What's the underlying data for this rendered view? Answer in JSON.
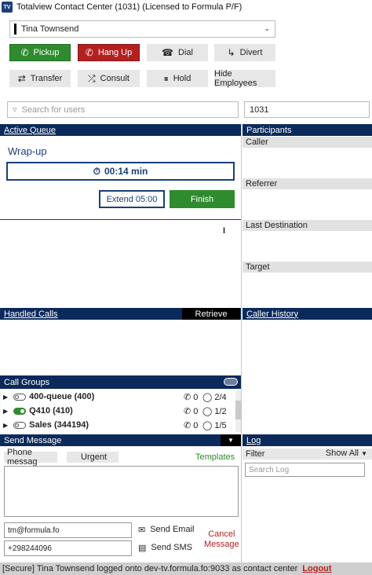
{
  "window": {
    "title": "Totalview Contact Center (1031) (Licensed to Formula P/F)",
    "logo": "TV"
  },
  "user_select": {
    "value": "Tina Townsend"
  },
  "actions": {
    "pickup": "Pickup",
    "hangup": "Hang Up",
    "dial": "Dial",
    "divert": "Divert",
    "transfer": "Transfer",
    "consult": "Consult",
    "hold": "Hold",
    "hide_employees": "Hide Employees"
  },
  "search": {
    "placeholder": "Search for users",
    "extension": "1031"
  },
  "active_queue": {
    "header": "Active Queue",
    "status": "Wrap-up",
    "timer": "00:14 min",
    "extend_label": "Extend 05:00",
    "finish_label": "Finish"
  },
  "participants": {
    "header": "Participants",
    "sections": [
      "Caller",
      "Referrer",
      "Last Destination",
      "Target"
    ]
  },
  "handled_calls": {
    "header": "Handled Calls",
    "retrieve_label": "Retrieve"
  },
  "caller_history": {
    "header": "Caller History"
  },
  "call_groups": {
    "header": "Call Groups",
    "rows": [
      {
        "name": "400-queue (400)",
        "active": false,
        "calls": "0",
        "agents": "2/4"
      },
      {
        "name": "Q410 (410)",
        "active": true,
        "calls": "0",
        "agents": "1/2"
      },
      {
        "name": "Sales (344194)",
        "active": false,
        "calls": "0",
        "agents": "1/5"
      }
    ]
  },
  "send_message": {
    "header": "Send Message",
    "tab_phone": "Phone messag",
    "tab_urgent": "Urgent",
    "templates": "Templates",
    "email_value": "tm@formula.fo",
    "phone_value": "+298244096",
    "send_email": "Send Email",
    "send_sms": "Send SMS",
    "cancel_line1": "Cancel",
    "cancel_line2": "Message"
  },
  "log": {
    "header": "Log",
    "filter_label": "Filter",
    "show_all": "Show All",
    "search_placeholder": "Search Log"
  },
  "status": {
    "text": "[Secure] Tina Townsend logged onto dev-tv.formula.fo:9033 as contact center",
    "logout": "Logout"
  },
  "colors": {
    "navy": "#0b2a5b",
    "green": "#2e8b2e",
    "red": "#b42020",
    "accent": "#1a3f7a"
  }
}
